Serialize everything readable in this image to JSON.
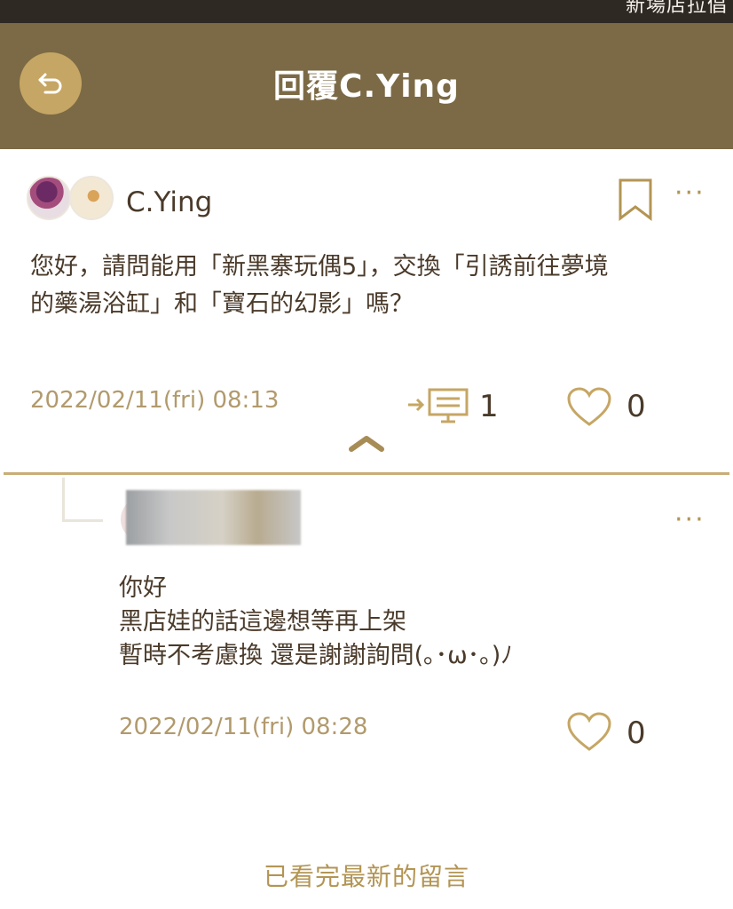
{
  "status_bar": {
    "text": "新場店拉倡"
  },
  "header": {
    "title": "回覆C.Ying",
    "back_icon": "back-arrow-icon"
  },
  "post": {
    "author": "C.Ying",
    "text_line1": "您好，請問能用「新黑寨玩偶5」，交換「引誘前往夢境",
    "text_line2": "的藥湯浴缸」和「寶石的幻影」嗎？",
    "timestamp": "2022/02/11(fri) 08:13",
    "reply_count": "1",
    "like_count": "0"
  },
  "reply": {
    "text_line1": "你好",
    "text_line2": "黑店娃的話這邊想等再上架",
    "text_line3": "暫時不考慮換 還是謝謝詢問(｡･ω･｡)ﾉ",
    "timestamp": "2022/02/11(fri) 08:28",
    "like_count": "0"
  },
  "footer": {
    "text": "已看完最新的留言"
  },
  "colors": {
    "header_bg": "#7b6a45",
    "accent": "#c6a664",
    "text": "#4a3a2a",
    "muted": "#b19a6c"
  }
}
